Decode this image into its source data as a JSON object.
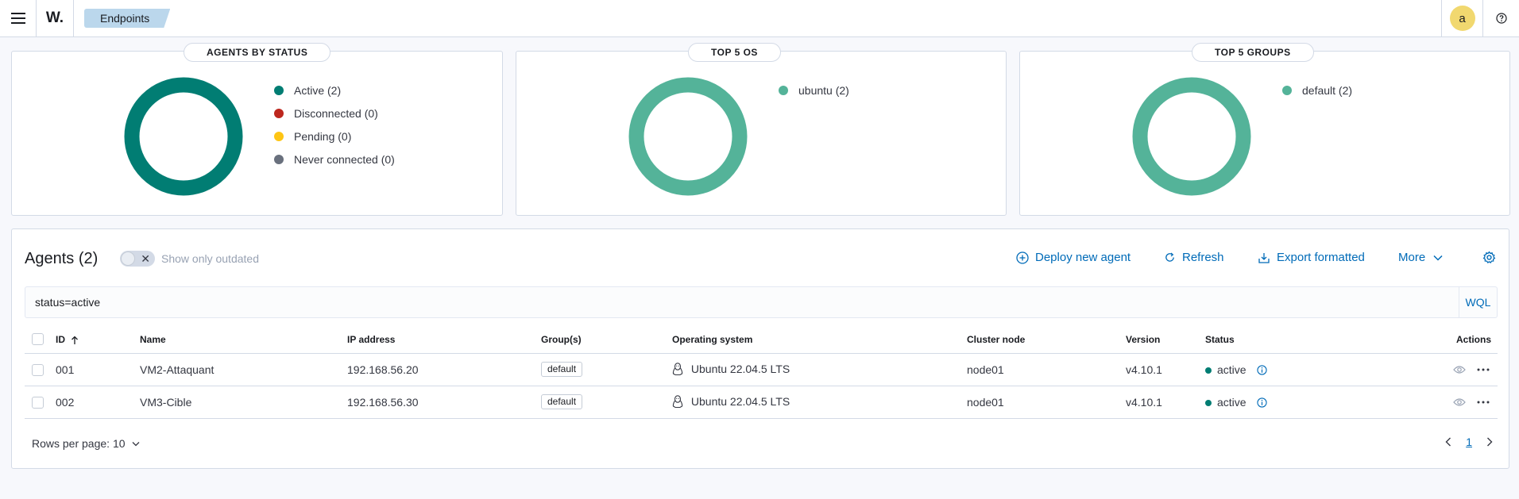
{
  "header": {
    "logo_text": "W.",
    "breadcrumb": "Endpoints",
    "avatar_initial": "a"
  },
  "stats": {
    "agents_by_status": {
      "title": "AGENTS BY STATUS",
      "items": [
        {
          "label": "Active (2)",
          "color": "#017d73",
          "value": 2
        },
        {
          "label": "Disconnected (0)",
          "color": "#bd271e",
          "value": 0
        },
        {
          "label": "Pending (0)",
          "color": "#fec514",
          "value": 0
        },
        {
          "label": "Never connected (0)",
          "color": "#69707d",
          "value": 0
        }
      ]
    },
    "top_os": {
      "title": "TOP 5 OS",
      "items": [
        {
          "label": "ubuntu (2)",
          "color": "#54b399",
          "value": 2
        }
      ]
    },
    "top_groups": {
      "title": "TOP 5 GROUPS",
      "items": [
        {
          "label": "default (2)",
          "color": "#54b399",
          "value": 2
        }
      ]
    }
  },
  "agents": {
    "title": "Agents (2)",
    "toggle_label": "Show only outdated",
    "actions": {
      "deploy": "Deploy new agent",
      "refresh": "Refresh",
      "export": "Export formatted",
      "more": "More"
    },
    "search": {
      "value": "status=active",
      "wql": "WQL"
    },
    "columns": {
      "id": "ID",
      "name": "Name",
      "ip": "IP address",
      "groups": "Group(s)",
      "os": "Operating system",
      "cluster": "Cluster node",
      "version": "Version",
      "status": "Status",
      "actions": "Actions"
    },
    "rows": [
      {
        "id": "001",
        "name": "VM2-Attaquant",
        "ip": "192.168.56.20",
        "group": "default",
        "os": "Ubuntu 22.04.5 LTS",
        "cluster": "node01",
        "version": "v4.10.1",
        "status": "active"
      },
      {
        "id": "002",
        "name": "VM3-Cible",
        "ip": "192.168.56.30",
        "group": "default",
        "os": "Ubuntu 22.04.5 LTS",
        "cluster": "node01",
        "version": "v4.10.1",
        "status": "active"
      }
    ],
    "pagination": {
      "rows_per_page": "Rows per page: 10",
      "current_page": "1"
    }
  }
}
